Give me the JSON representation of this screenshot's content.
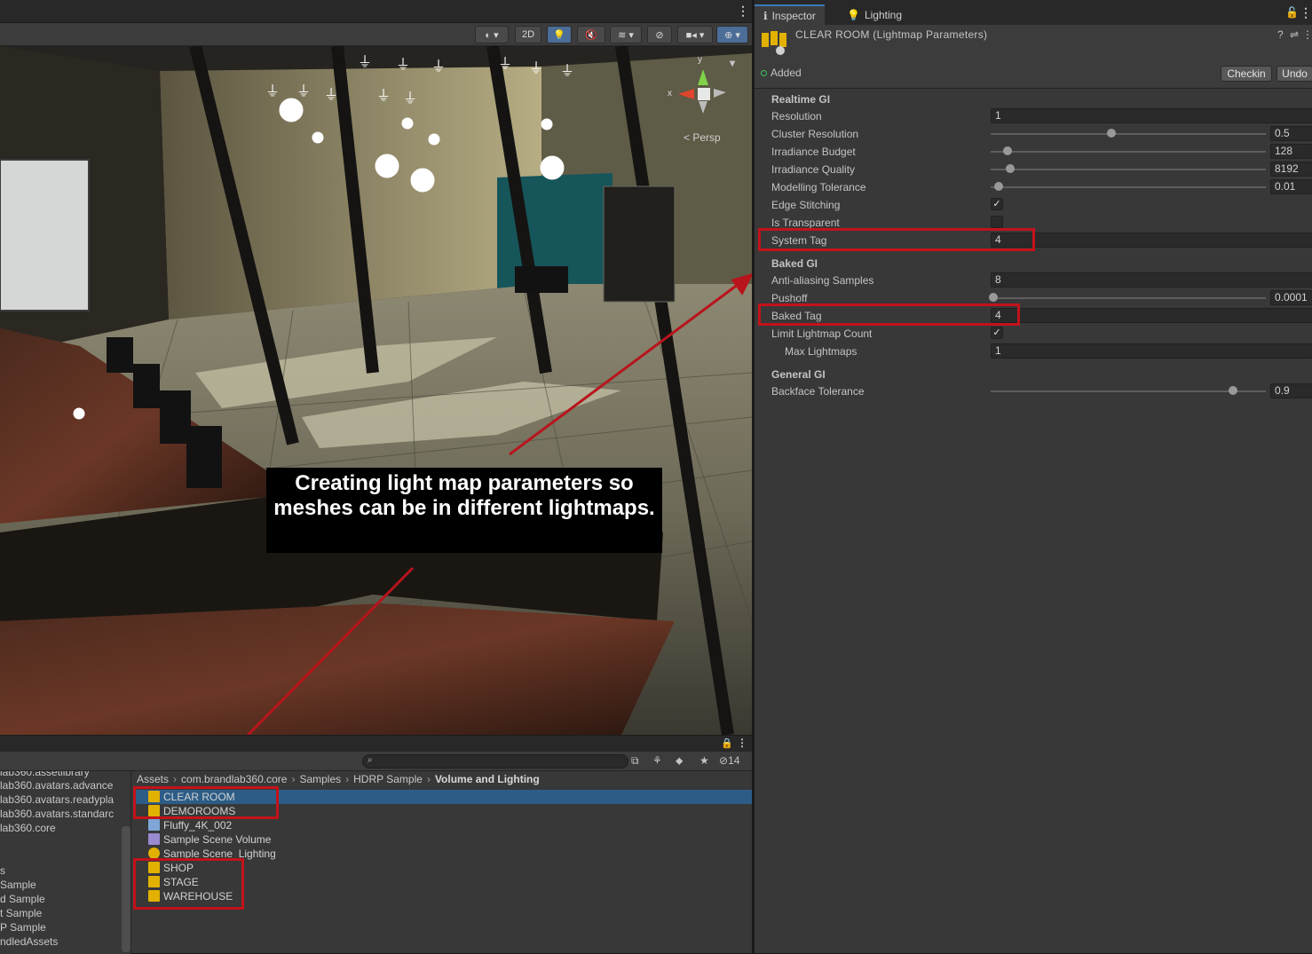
{
  "scene": {
    "toolbar": {
      "btn_2d": "2D"
    },
    "gizmo": {
      "axis_y": "y",
      "axis_x": "x",
      "projection": "Persp"
    },
    "callout": "Creating light map parameters so meshes can be in different lightmaps."
  },
  "inspector": {
    "tabs": [
      {
        "label": "Inspector",
        "icon": "info-icon"
      },
      {
        "label": "Lighting",
        "icon": "lightbulb-icon"
      }
    ],
    "title": "CLEAR ROOM (Lightmap Parameters)",
    "status": "Added",
    "checkin_label": "Checkin",
    "undo_label": "Undo",
    "realtime_gi": {
      "heading": "Realtime GI",
      "resolution": {
        "label": "Resolution",
        "value": "1"
      },
      "cluster_resolution": {
        "label": "Cluster Resolution",
        "value": "0.5",
        "fraction": 0.44
      },
      "irradiance_budget": {
        "label": "Irradiance Budget",
        "value": "128",
        "fraction": 0.06
      },
      "irradiance_quality": {
        "label": "Irradiance Quality",
        "value": "8192",
        "fraction": 0.07
      },
      "modelling_tolerance": {
        "label": "Modelling Tolerance",
        "value": "0.01",
        "fraction": 0.03
      },
      "edge_stitching": {
        "label": "Edge Stitching",
        "checked": true
      },
      "is_transparent": {
        "label": "Is Transparent",
        "checked": false
      },
      "system_tag": {
        "label": "System Tag",
        "value": "4"
      }
    },
    "baked_gi": {
      "heading": "Baked GI",
      "anti_aliasing": {
        "label": "Anti-aliasing Samples",
        "value": "8"
      },
      "pushoff": {
        "label": "Pushoff",
        "value": "0.0001",
        "fraction": 0.01
      },
      "baked_tag": {
        "label": "Baked Tag",
        "value": "4"
      },
      "limit_lightmap_count": {
        "label": "Limit Lightmap Count",
        "checked": true
      },
      "max_lightmaps": {
        "label": "Max Lightmaps",
        "value": "1"
      }
    },
    "general_gi": {
      "heading": "General GI",
      "backface_tolerance": {
        "label": "Backface Tolerance",
        "value": "0.9",
        "fraction": 0.88
      }
    },
    "highlight_color": "#c3121a"
  },
  "project": {
    "hidden_count": "14",
    "tree": [
      "lab360.assetlibrary",
      "lab360.avatars.advance",
      "lab360.avatars.readypla",
      "lab360.avatars.standarc",
      "lab360.core",
      "s",
      "Sample",
      "d Sample",
      "t Sample",
      "P Sample",
      "ndledAssets"
    ],
    "breadcrumb": [
      "Assets",
      "com.brandlab360.core",
      "Samples",
      "HDRP Sample",
      "Volume and Lighting"
    ],
    "assets": [
      {
        "name": "CLEAR ROOM",
        "icon": "lightmap-params-icon",
        "selected": true
      },
      {
        "name": "DEMOROOMS",
        "icon": "lightmap-params-icon"
      },
      {
        "name": "Fluffy_4K_002",
        "icon": "texture-icon"
      },
      {
        "name": "Sample Scene Volume",
        "icon": "volume-profile-icon"
      },
      {
        "name": "Sample Scene_Lighting",
        "icon": "lighting-settings-icon"
      },
      {
        "name": "SHOP",
        "icon": "lightmap-params-icon"
      },
      {
        "name": "STAGE",
        "icon": "lightmap-params-icon"
      },
      {
        "name": "WAREHOUSE",
        "icon": "lightmap-params-icon"
      }
    ]
  }
}
